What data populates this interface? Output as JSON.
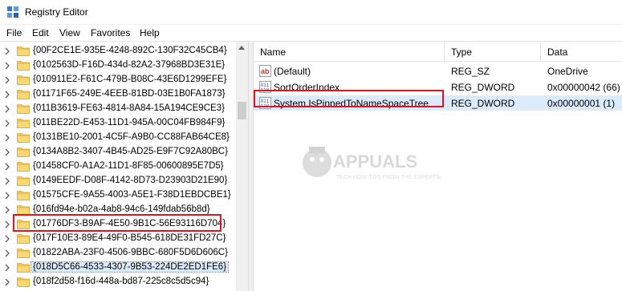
{
  "window": {
    "title": "Registry Editor"
  },
  "menu": [
    "File",
    "Edit",
    "View",
    "Favorites",
    "Help"
  ],
  "tree": {
    "items": [
      {
        "label": "{00F2CE1E-935E-4248-892C-130F32C45CB4}",
        "selected": false
      },
      {
        "label": "{0102563D-F16D-434d-82A2-37968BD3E31E}",
        "selected": false
      },
      {
        "label": "{010911E2-F61C-479B-B08C-43E6D1299EFE}",
        "selected": false
      },
      {
        "label": "{01171F65-249E-4EEB-81BD-03E1B0FA1873}",
        "selected": false
      },
      {
        "label": "{011B3619-FE63-4814-8A84-15A194CE9CE3}",
        "selected": false
      },
      {
        "label": "{011BE22D-E453-11D1-945A-00C04FB984F9}",
        "selected": false
      },
      {
        "label": "{0131BE10-2001-4C5F-A9B0-CC88FAB64CE8}",
        "selected": false
      },
      {
        "label": "{0134A8B2-3407-4B45-AD25-E9F7C92A80BC}",
        "selected": false
      },
      {
        "label": "{01458CF0-A1A2-11D1-8F85-00600895E7D5}",
        "selected": false
      },
      {
        "label": "{0149EEDF-D08F-4142-8D73-D23903D21E90}",
        "selected": false
      },
      {
        "label": "{01575CFE-9A55-4003-A5E1-F38D1EBDCBE1}",
        "selected": false
      },
      {
        "label": "{016fd94e-b02a-4ab8-94c6-149fdab56b8d}",
        "selected": false
      },
      {
        "label": "{01776DF3-B9AF-4E50-9B1C-56E93116D704}",
        "selected": false
      },
      {
        "label": "{017F10E3-89E4-49F0-B545-618DE31FD27C}",
        "selected": false
      },
      {
        "label": "{01822ABA-23F0-4506-9BBC-680F5D6D606C}",
        "selected": false
      },
      {
        "label": "{018D5C66-4533-4307-9B53-224DE2ED1FE6}",
        "selected": true
      },
      {
        "label": "{018f2d58-f16d-448a-bd87-225c8c5d5c94}",
        "selected": false
      }
    ]
  },
  "list": {
    "columns": [
      "Name",
      "Type",
      "Data"
    ],
    "rows": [
      {
        "icon": "string-value-icon",
        "name": "(Default)",
        "type": "REG_SZ",
        "data": "OneDrive",
        "selected": false
      },
      {
        "icon": "binary-value-icon",
        "name": "SortOrderIndex",
        "type": "REG_DWORD",
        "data": "0x00000042 (66)",
        "selected": false
      },
      {
        "icon": "binary-value-icon",
        "name": "System.IsPinnedToNameSpaceTree",
        "type": "REG_DWORD",
        "data": "0x00000001 (1)",
        "selected": true
      }
    ]
  },
  "watermark": {
    "brand": "APPUALS",
    "tagline": "TECH HOW-TO'S FROM THE EXPERTS!"
  },
  "colors": {
    "highlight_box": "#e0131f",
    "selection": "#dcebfc",
    "folder": "#f4c95d"
  }
}
